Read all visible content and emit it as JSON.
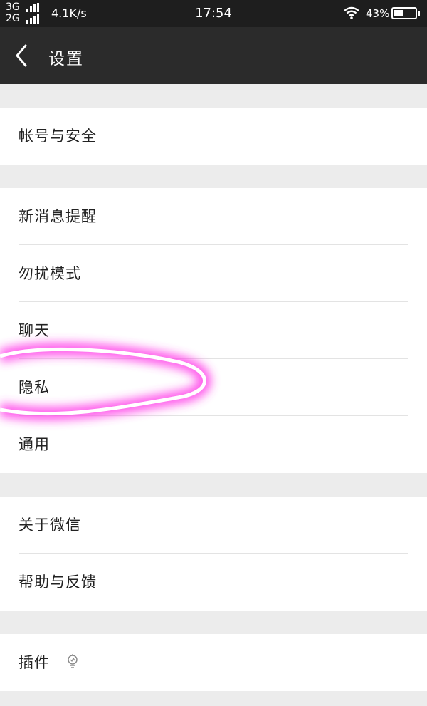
{
  "status_bar": {
    "network_top": "3G",
    "network_bottom": "2G",
    "speed": "4.1K/s",
    "time": "17:54",
    "battery_percent": "43%",
    "battery_level": 0.43
  },
  "header": {
    "back_icon": "chevron-left-icon",
    "title": "设置"
  },
  "groups": [
    {
      "items": [
        {
          "label": "帐号与安全"
        }
      ]
    },
    {
      "items": [
        {
          "label": "新消息提醒"
        },
        {
          "label": "勿扰模式"
        },
        {
          "label": "聊天"
        },
        {
          "label": "隐私"
        },
        {
          "label": "通用"
        }
      ]
    },
    {
      "items": [
        {
          "label": "关于微信"
        },
        {
          "label": "帮助与反馈"
        }
      ]
    },
    {
      "items": [
        {
          "label": "插件",
          "icon": "lightbulb-icon"
        }
      ]
    }
  ],
  "colors": {
    "status_bar": "#1e1e1e",
    "title_bar": "#2b2b2b",
    "background": "#ececec",
    "highlight": "#ff3ee8"
  }
}
